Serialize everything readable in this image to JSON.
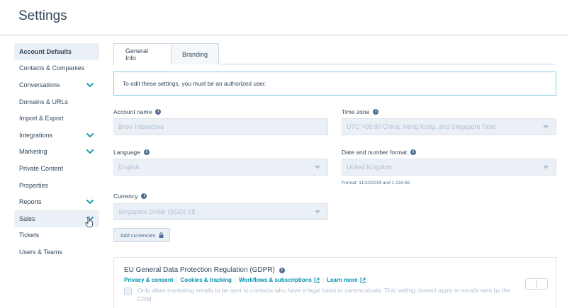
{
  "header": {
    "title": "Settings"
  },
  "sidebar": {
    "items": [
      {
        "label": "Account Defaults",
        "state": "active",
        "expandable": false
      },
      {
        "label": "Contacts & Companies",
        "expandable": false
      },
      {
        "label": "Conversations",
        "expandable": true
      },
      {
        "label": "Domains & URLs",
        "expandable": false
      },
      {
        "label": "Import & Export",
        "expandable": false
      },
      {
        "label": "Integrations",
        "expandable": true
      },
      {
        "label": "Marketing",
        "expandable": true
      },
      {
        "label": "Private Content",
        "expandable": false
      },
      {
        "label": "Properties",
        "expandable": false
      },
      {
        "label": "Reports",
        "expandable": true
      },
      {
        "label": "Sales",
        "state": "hover",
        "expandable": true
      },
      {
        "label": "Tickets",
        "expandable": false
      },
      {
        "label": "Users & Teams",
        "expandable": false
      }
    ]
  },
  "tabs": [
    {
      "label": "General Info",
      "active": true
    },
    {
      "label": "Branding",
      "active": false
    }
  ],
  "notice": "To edit these settings, you must be an authorized user.",
  "fields": {
    "account_name": {
      "label": "Account name",
      "value": "Brew Interactive"
    },
    "time_zone": {
      "label": "Time zone",
      "value": "UTC +08:00 China, Hong Kong, and Singapore Time"
    },
    "language": {
      "label": "Language",
      "value": "English"
    },
    "date_format": {
      "label": "Date and number format",
      "value": "United Kingdom",
      "hint": "Format: 11/10/2019 and 1,234.56"
    },
    "currency": {
      "label": "Currency",
      "value": "Singapore Dollar (SGD) S$"
    }
  },
  "add_currencies": "Add currencies",
  "gdpr": {
    "title": "EU General Data Protection Regulation (GDPR)",
    "links": [
      "Privacy & consent",
      "Cookies & tracking",
      "Workflows & subscriptions",
      "Learn more"
    ],
    "separator": "|",
    "checkbox_text": "Only allow marketing emails to be sent to contacts who have a legal basis to communicate. This setting doesn't apply to emails sent by the CRM."
  },
  "colors": {
    "accent": "#0091ae",
    "text": "#33475b",
    "border": "#cbd6e2",
    "notice_border": "#7fd1de",
    "disabled_bg": "#eaf0f6",
    "disabled_text": "#b0c1d4"
  }
}
